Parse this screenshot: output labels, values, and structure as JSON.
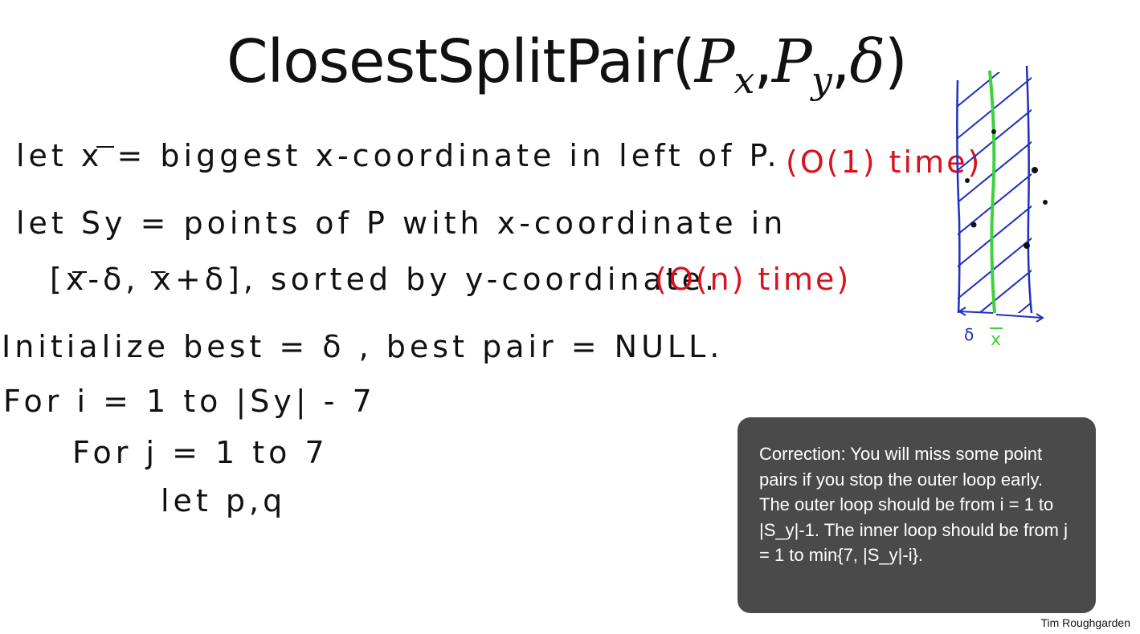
{
  "slide": {
    "title": {
      "name": "ClosestSplitPair",
      "open": "(",
      "arg1": "P",
      "sub1": "x",
      "sep1": ",",
      "arg2": "P",
      "sub2": "y",
      "sep2": ",",
      "arg3": "δ",
      "close": ")"
    },
    "lines": [
      "let x = biggest x-coordinate in left of P.",
      "(O(1) time)",
      "let Sy = points of P with x-coordinate in",
      "[x-δ, x+δ], sorted by y-coordinate.",
      "(O(n) time)",
      "Initialize best = δ , best pair = NULL.",
      "For i = 1 to |Sy| - 7",
      "For j = 1 to 7",
      "let p,q"
    ],
    "figure": {
      "delta_label": "δ",
      "xbar_label": "x"
    },
    "callout": {
      "text": "Correction: You will miss some point pairs if you stop the outer loop early. The outer loop should be from i = 1 to |S_y|-1. The inner loop should be from j = 1 to min{7, |S_y|-i}."
    },
    "author": "Tim Roughgarden"
  },
  "colors": {
    "ink": "#111111",
    "red": "#d8121c",
    "blue": "#1f2fbf",
    "green": "#3ed13e",
    "callout_bg": "#4a4a4a"
  }
}
